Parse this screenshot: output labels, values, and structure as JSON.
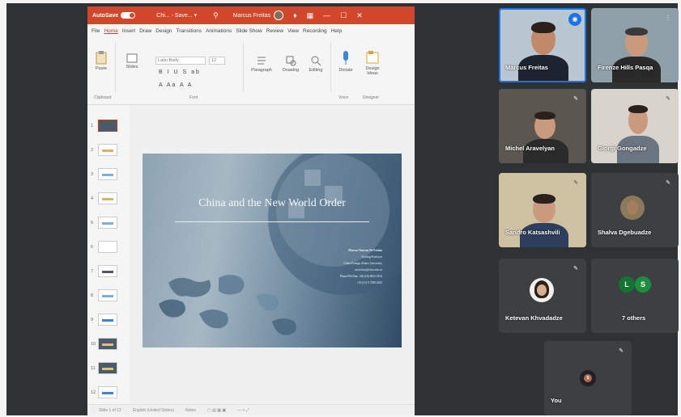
{
  "ppt": {
    "titlebar": {
      "autosave": "AutoSave",
      "toggle": "On",
      "doc_name": "Chi... - Save... ▾",
      "user": "Marcus Freitas",
      "controls": [
        "—",
        "☐",
        "✕"
      ]
    },
    "menu": [
      "File",
      "Home",
      "Insert",
      "Draw",
      "Design",
      "Transitions",
      "Animations",
      "Slide Show",
      "Review",
      "View",
      "Recording",
      "Help"
    ],
    "menu_active": "Home",
    "ribbon": {
      "paste": "Paste",
      "slides": "Slides",
      "font_name": "Latin Body",
      "font_size": "12",
      "format_row1": "B I U S ab",
      "format_row2": "A Aa A A",
      "paragraph": "Paragraph",
      "drawing": "Drawing",
      "editing": "Editing",
      "dictate": "Dictate",
      "designer": "Design Ideas",
      "group_clipboard": "Clipboard",
      "group_font": "Font",
      "group_voice": "Voice",
      "group_designer": "Designer"
    },
    "thumbnails": [
      "1",
      "2",
      "3",
      "4",
      "5",
      "6",
      "7",
      "8",
      "9",
      "10",
      "11",
      "12"
    ],
    "slide": {
      "title": "China and the New World Order",
      "info_lines": [
        "Marcus Vinicius De Freitas",
        "Visiting Professor",
        "China Foreign Affairs University",
        "mvfreitas@cfau.edu.cn",
        "Phone/WeChat: +86 (10) 6832 0154",
        "+55 (11) 9 7580 2625"
      ]
    },
    "status": [
      "Slide 1 of 12",
      "English (United States)",
      "Notes",
      "▢  ▤  ▦  ▣",
      "—  +  ⤢"
    ],
    "colors": {
      "accent": "#d2472a"
    }
  },
  "meet": {
    "tiles": [
      {
        "name": "Marcus Freitas",
        "speaking": true
      },
      {
        "name": "Firenze Hills Pasqa"
      },
      {
        "name": "Michel Aravelyan"
      },
      {
        "name": "Giorgi Gongadze"
      },
      {
        "name": "Sandro Katsashvili"
      },
      {
        "name": "Shalva Dgebuadze"
      },
      {
        "name": "Ketevan Khvadadze"
      },
      {
        "name": "7 others",
        "avatars": [
          "L",
          "S"
        ]
      },
      {
        "name": "You",
        "avatar": "S"
      }
    ],
    "colors": {
      "speaking": "#1a73e8",
      "tile": "#3c4043",
      "bg": "#2e3235"
    }
  }
}
